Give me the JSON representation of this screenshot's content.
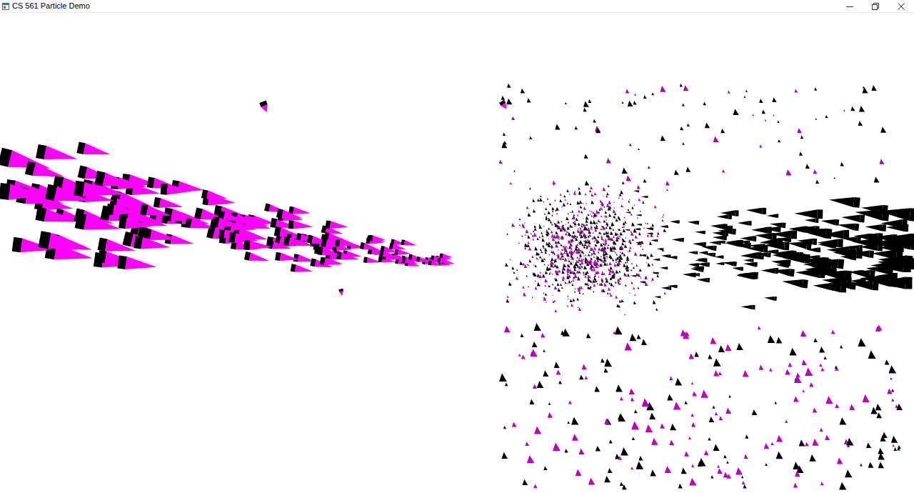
{
  "window": {
    "title": "CS 561 Particle Demo"
  }
}
